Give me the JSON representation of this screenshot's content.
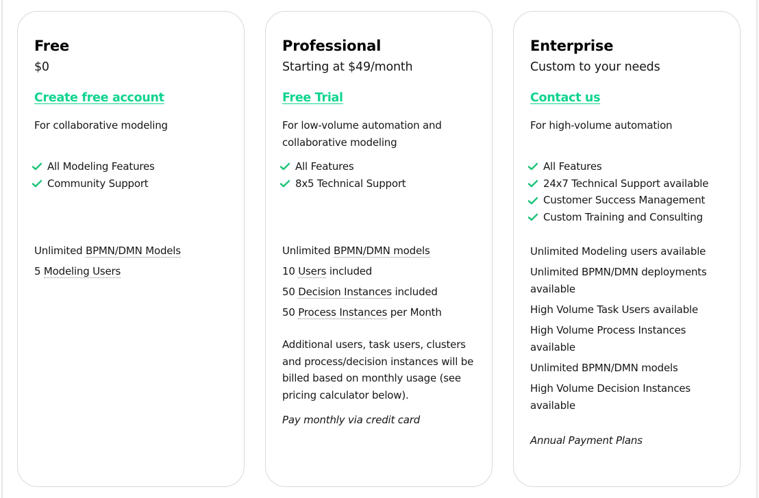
{
  "colors": {
    "accent": "#10d48e",
    "text": "#161616",
    "border": "#d9d9d9"
  },
  "plans": [
    {
      "name": "Free",
      "price": "$0",
      "cta": "Create free account",
      "description": "For collaborative modeling",
      "features": [
        "All Modeling Features",
        "Community Support"
      ],
      "limits": [
        {
          "prefix": "Unlimited ",
          "term": "BPMN/DMN Models",
          "suffix": ""
        },
        {
          "prefix": "5 ",
          "term": "Modeling Users",
          "suffix": ""
        }
      ]
    },
    {
      "name": "Professional",
      "price": "Starting at $49/month",
      "cta": "Free Trial",
      "description": "For low-volume automation and collaborative modeling",
      "features": [
        "All Features",
        "8x5 Technical Support"
      ],
      "limits": [
        {
          "prefix": "Unlimited ",
          "term": "BPMN/DMN models",
          "suffix": ""
        },
        {
          "prefix": "10 ",
          "term": "Users",
          "suffix": " included"
        },
        {
          "prefix": "50 ",
          "term": "Decision Instances",
          "suffix": " included"
        },
        {
          "prefix": "50 ",
          "term": "Process Instances",
          "suffix": " per Month"
        }
      ],
      "note": "Additional users, task users, clusters and process/decision instances will be billed based on monthly usage (see pricing calculator below).",
      "payment": "Pay monthly via credit card"
    },
    {
      "name": "Enterprise",
      "price": "Custom to your needs",
      "cta": "Contact us",
      "description": "For high-volume automation",
      "features": [
        "All Features",
        "24x7 Technical Support available",
        "Customer Success Management",
        "Custom Training and Consulting"
      ],
      "limits": [
        "Unlimited Modeling users available",
        "Unlimited BPMN/DMN deployments available",
        "High Volume Task Users available",
        "High Volume Process Instances available",
        "Unlimited BPMN/DMN models",
        "High Volume Decision Instances available"
      ],
      "payment": "Annual Payment Plans"
    }
  ],
  "icons": {
    "feature_bullet": "check-icon"
  }
}
